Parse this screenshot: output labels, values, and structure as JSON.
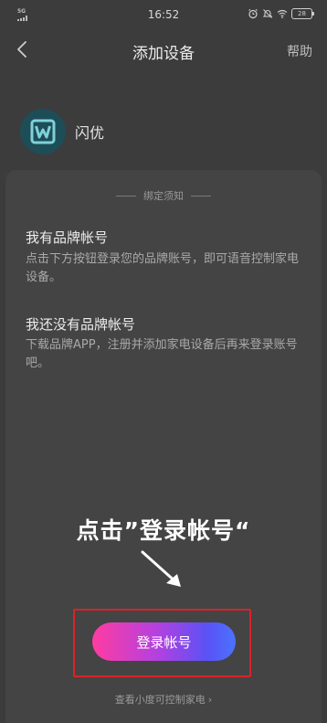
{
  "status_bar": {
    "network": "5G",
    "time": "16:52",
    "battery": "28"
  },
  "nav": {
    "title": "添加设备",
    "help": "帮助"
  },
  "brand": {
    "name": "闪优"
  },
  "notice_title": "绑定须知",
  "sections": [
    {
      "heading": "我有品牌帐号",
      "text": "点击下方按钮登录您的品牌账号，即可语音控制家电设备。"
    },
    {
      "heading": "我还没有品牌帐号",
      "text": "下载品牌APP，注册并添加家电设备后再来登录账号吧。"
    }
  ],
  "annotation": "点击”登录帐号“",
  "login_button": "登录帐号",
  "xiaodu_link": "查看小度可控制家电",
  "colors": {
    "background": "#3c3c3c",
    "brand_logo": "#1d4d57",
    "highlight": "#d8232a",
    "button_gradient_start": "#ff3ca1",
    "button_gradient_end": "#4b73ff"
  }
}
